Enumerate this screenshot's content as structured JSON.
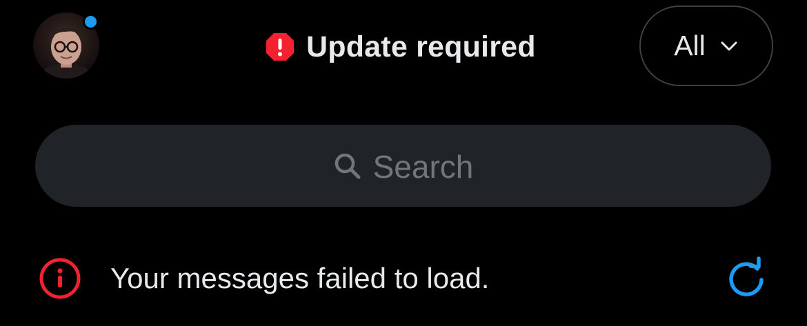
{
  "header": {
    "title": "Update required",
    "avatar_icon": "profile-photo-avatar",
    "status_icon": "octagon-exclamation-icon",
    "notification_dot_color": "#1d9bf0",
    "alert_color": "#f4212e"
  },
  "filter": {
    "label": "All",
    "icon": "chevron-down-icon"
  },
  "search": {
    "placeholder": "Search",
    "icon": "search-icon"
  },
  "messages": {
    "error_text": "Your messages failed to load.",
    "error_icon": "info-circle-icon",
    "retry_icon": "refresh-icon",
    "error_color": "#f4212e",
    "retry_color": "#1d9bf0"
  }
}
